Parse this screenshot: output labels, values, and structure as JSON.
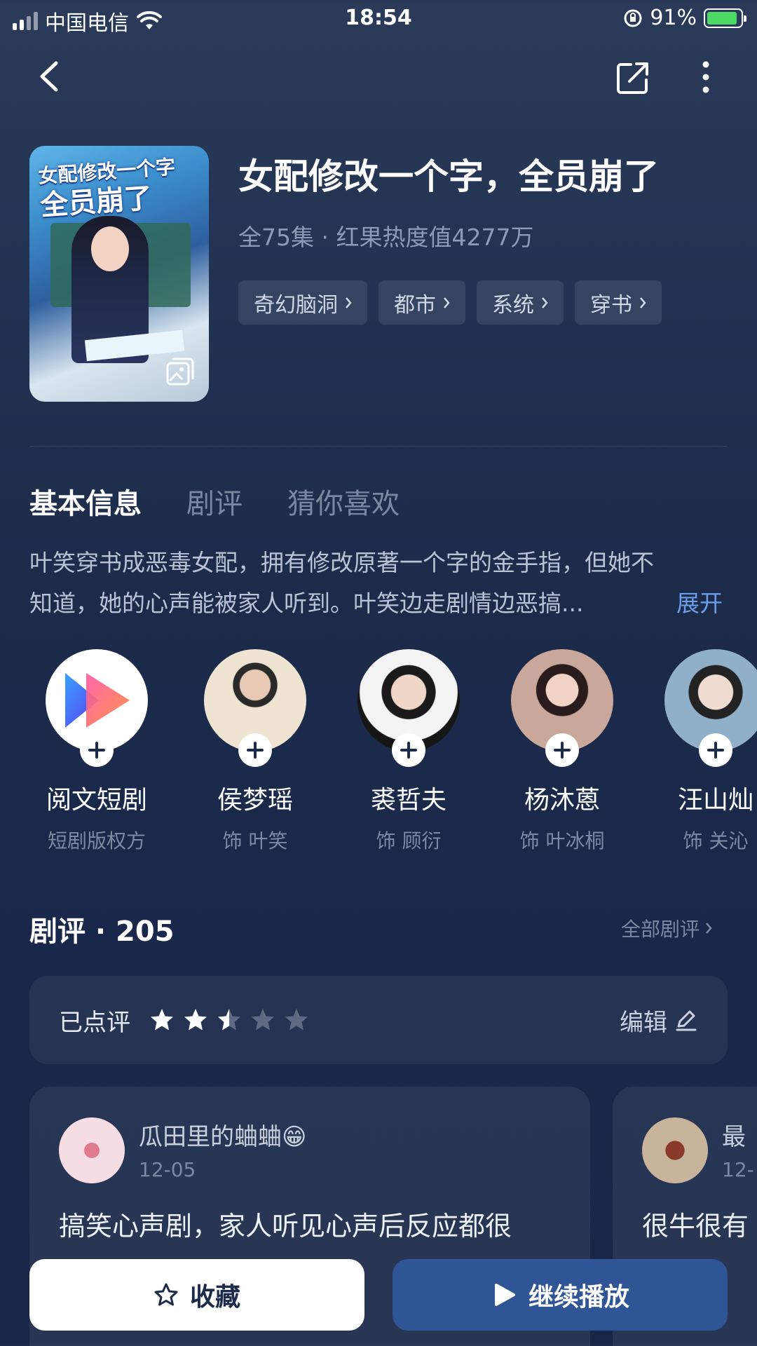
{
  "status_bar": {
    "carrier": "中国电信",
    "time": "18:54",
    "battery_percent": "91%",
    "battery_level": 0.91
  },
  "nav": {
    "back_icon": "chevron-left-icon",
    "share_icon": "share-icon",
    "more_icon": "more-vertical-icon"
  },
  "show": {
    "poster_title_line1": "女配修改一个字",
    "poster_title_line2": "全员崩了",
    "title": "女配修改一个字，全员崩了",
    "meta": "全75集 · 红果热度值4277万",
    "tags": [
      "奇幻脑洞",
      "都市",
      "系统",
      "穿书"
    ]
  },
  "tabs": [
    {
      "label": "基本信息",
      "active": true
    },
    {
      "label": "剧评",
      "active": false
    },
    {
      "label": "猜你喜欢",
      "active": false
    }
  ],
  "synopsis": {
    "line1": "叶笑穿书成恶毒女配，拥有修改原著一个字的金手指，但她不",
    "line2": "知道，她的心声能被家人听到。叶笑边走剧情边恶搞...",
    "expand_label": "展开"
  },
  "cast": [
    {
      "name": "阅文短剧",
      "role": "短剧版权方"
    },
    {
      "name": "侯梦瑶",
      "role": "饰 叶笑"
    },
    {
      "name": "裘哲夫",
      "role": "饰 顾衍"
    },
    {
      "name": "杨沐蒽",
      "role": "饰 叶冰桐"
    },
    {
      "name": "汪山灿",
      "role": "饰 关沁"
    }
  ],
  "reviews": {
    "title": "剧评 · 205",
    "all_label": "全部剧评",
    "rated_label": "已点评",
    "rating": 2.5,
    "rating_max": 5,
    "edit_label": "编辑",
    "items": [
      {
        "user": "瓜田里的蛐蛐😁",
        "date": "12-05",
        "text": "搞笑心声剧，家人听见心声后反应都很"
      },
      {
        "user": "最",
        "date": "12-",
        "text": "很牛很有"
      }
    ]
  },
  "actions": {
    "favorite_label": "收藏",
    "play_label": "继续播放"
  },
  "colors": {
    "accent_blue": "#2f5597",
    "link_blue": "#6c9ee8",
    "background": "#1c2b4a"
  }
}
